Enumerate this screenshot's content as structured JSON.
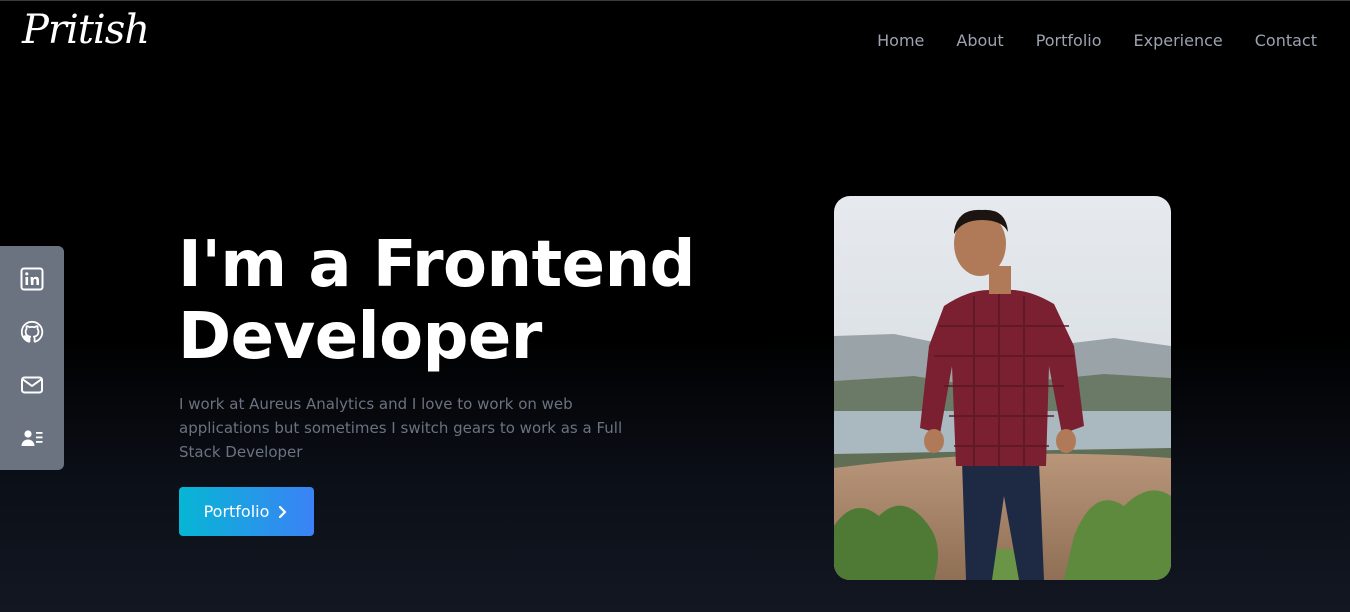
{
  "header": {
    "logo_text": "Pritish",
    "nav": [
      "Home",
      "About",
      "Portfolio",
      "Experience",
      "Contact"
    ]
  },
  "social": [
    {
      "name": "linkedin-icon"
    },
    {
      "name": "github-icon"
    },
    {
      "name": "mail-icon"
    },
    {
      "name": "contact-card-icon"
    }
  ],
  "hero": {
    "heading_line1": "I'm a Frontend",
    "heading_line2": "Developer",
    "description": "I work at Aureus Analytics and I love to work on web applications but sometimes I switch gears to work as a Full Stack Developer",
    "cta_label": "Portfolio"
  },
  "colors": {
    "background": "#000000",
    "social_bar": "#6b7280",
    "nav_text": "#9ca3af",
    "cta_gradient_start": "#06b6d4",
    "cta_gradient_end": "#3b82f6"
  }
}
